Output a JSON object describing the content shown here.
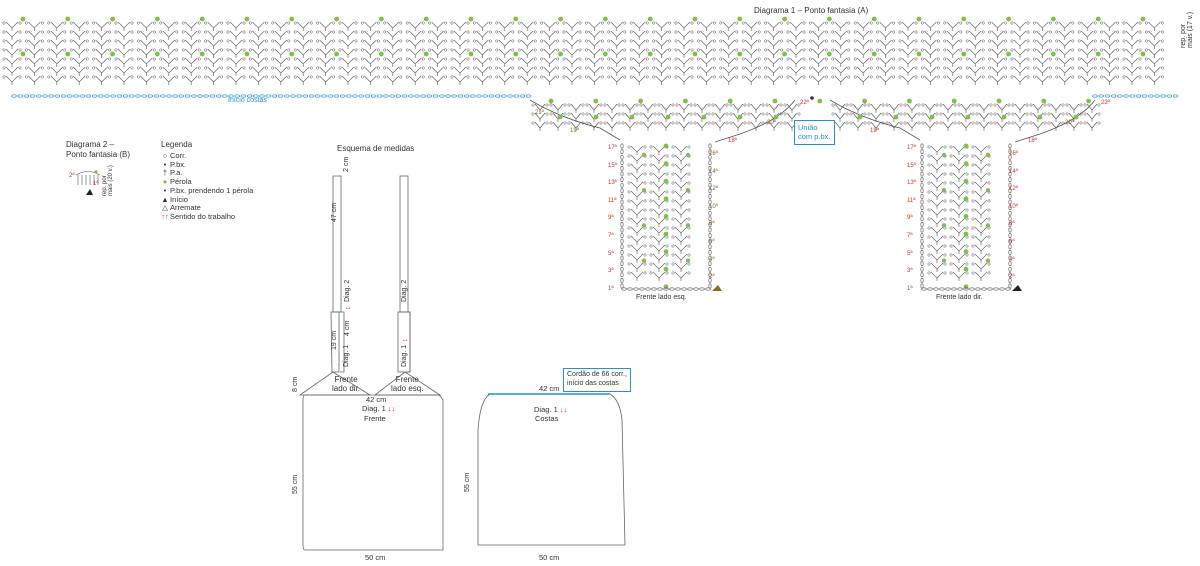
{
  "diagram1": {
    "title": "Diagrama 1 – Ponto fantasia (A)",
    "start_back_label": "Início costas",
    "union_callout": [
      "União",
      "com p.bx."
    ],
    "side_note": [
      "rep. por",
      "mais (17 v.)"
    ],
    "front_left_label": "Frente lado esq.",
    "front_right_label": "Frente lado dir.",
    "corner_labels": {
      "left_21": "21ª",
      "left_19": "19ª",
      "left_20": "20ª",
      "left_18": "18ª",
      "left_22": "22ª",
      "right_22": "22ª",
      "right_19": "19ª",
      "right_20": "20ª",
      "right_18": "18ª"
    },
    "row_numbers_left_odd": [
      "17ª",
      "15ª",
      "13ª",
      "11ª",
      "9ª",
      "7ª",
      "5ª",
      "3ª",
      "1ª"
    ],
    "row_numbers_left_even": [
      "16ª",
      "14ª",
      "12ª",
      "10ª",
      "8ª",
      "6ª",
      "4ª",
      "2ª"
    ],
    "row_numbers_right_odd": [
      "17ª",
      "15ª",
      "13ª",
      "11ª",
      "9ª",
      "7ª",
      "5ª",
      "3ª",
      "1ª"
    ],
    "row_numbers_right_even": [
      "16ª",
      "14ª",
      "12ª",
      "10ª",
      "8ª",
      "6ª",
      "4ª",
      "2ª"
    ]
  },
  "diagram2": {
    "title_line1": "Diagrama 2 –",
    "title_line2": "Ponto fantasia (B)",
    "row2_label": "2ª",
    "row1_label": "1ª",
    "side_note": [
      "rep. por",
      "mais (20 v.)"
    ]
  },
  "legend": {
    "title": "Legenda",
    "items": [
      {
        "symbol": "○",
        "label": "Corr.",
        "color": "#333333"
      },
      {
        "symbol": "•",
        "label": "P.bx.",
        "color": "#333333"
      },
      {
        "symbol": "†",
        "label": "P.a.",
        "color": "#333333"
      },
      {
        "symbol": "●",
        "label": "Pérola",
        "color": "#7cc24a"
      },
      {
        "symbol": "•",
        "label": "P.bx. prendendo 1 pérola",
        "color": "#333333"
      },
      {
        "symbol": "▲",
        "label": "Início",
        "color": "#333333"
      },
      {
        "symbol": "△",
        "label": "Arremate",
        "color": "#333333"
      },
      {
        "symbol": "↑↑",
        "label": "Sentido do trabalho",
        "color": "#d0342c"
      }
    ]
  },
  "schema": {
    "title": "Esquema de medidas",
    "strap_top": "2 cm",
    "strap_length": "47 cm",
    "diag2_label": "Diag. 2",
    "band_19": "19 cm",
    "band_4": "4 cm",
    "diag1_label": "Diag. 1",
    "arrow_red": "↕",
    "front_right_label": [
      "Frente",
      "lado dir."
    ],
    "front_left_label": [
      "Frente",
      "lado esq."
    ],
    "height_8": "8 cm",
    "top_width": "42 cm",
    "front_diag_label": "Diag. 1",
    "front_arrows": "↓↓",
    "front_label": "Frente",
    "height_55": "55 cm",
    "bottom_width": "50 cm",
    "back_callout": [
      "Cordão de 66 corr.,",
      "início das costas"
    ],
    "back_top_width": "42 cm",
    "back_diag_label": "Diag. 1",
    "back_label": "Costas",
    "back_height": "55 cm",
    "back_bottom_width": "50 cm"
  },
  "colors": {
    "bead": "#7cc24a",
    "start_row": "#2a8fd0",
    "row_red": "#d0342c",
    "row_brown": "#8a6a2a",
    "line": "#555555"
  }
}
